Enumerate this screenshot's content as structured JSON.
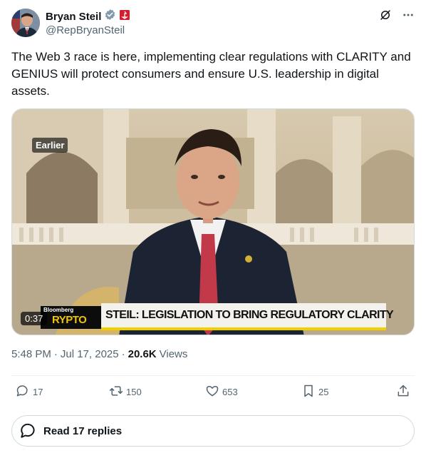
{
  "author": {
    "display_name": "Bryan Steil",
    "handle": "@RepBryanSteil",
    "verified_icon": "verified-badge-icon",
    "affiliation_icon": "house-seal-icon"
  },
  "header": {
    "grok_icon": "grok-icon",
    "more_icon": "more-icon"
  },
  "tweet": {
    "text": "The Web 3 race is here, implementing clear regulations with CLARITY and GENIUS will protect consumers and ensure U.S. leadership in digital assets."
  },
  "media": {
    "badge": "Earlier",
    "duration": "0:37",
    "network": "Bloomberg",
    "show": "RYPTO",
    "headline": "STEIL: LEGISLATION TO BRING REGULATORY CLARITY"
  },
  "meta": {
    "time": "5:48 PM",
    "separator": "·",
    "date": "Jul 17, 2025",
    "views_count": "20.6K",
    "views_label": "Views"
  },
  "actions": {
    "replies": "17",
    "reposts": "150",
    "likes": "653",
    "bookmarks": "25"
  },
  "read_replies": {
    "label": "Read 17 replies"
  },
  "colors": {
    "text": "#0f1419",
    "secondary": "#536471",
    "verified": "#829aab",
    "house_red": "#d0202e",
    "lower_third_yellow": "#f0d000"
  }
}
